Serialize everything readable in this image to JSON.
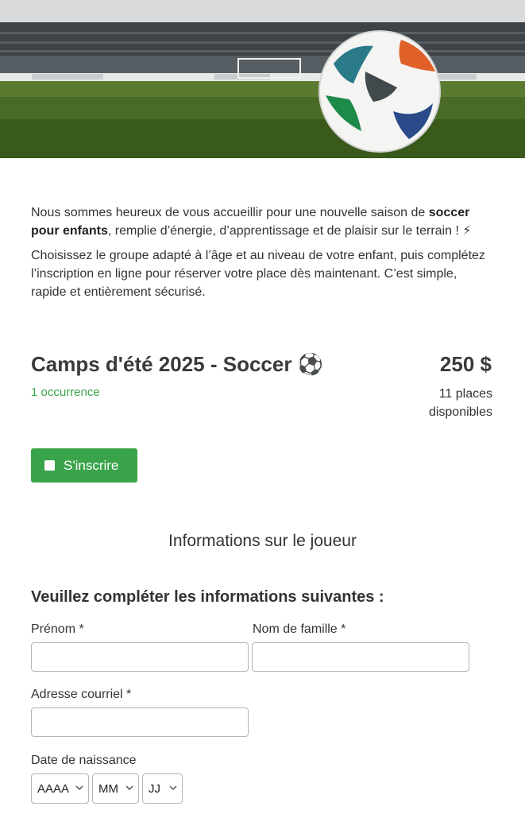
{
  "hero": {
    "image_name": "soccer-ball-stadium-image"
  },
  "intro": {
    "p1_a": "Nous sommes heureux de vous accueillir pour une nouvelle saison de",
    "p1_bold": "soccer pour enfants",
    "p1_b": ", remplie d’énergie, d’apprentissage et de plaisir sur le terrain ! ⚡",
    "p2": "Choisissez le groupe adapté à l’âge et au niveau de votre enfant, puis complétez l’inscription en ligne pour réserver votre place dès maintenant. C’est simple, rapide et entièrement sécurisé."
  },
  "event": {
    "title": "Camps d'été 2025 - Soccer ⚽",
    "occurrences": "1 occurrence",
    "price": "250 $",
    "places": "11 places disponibles"
  },
  "register_button": {
    "label": "S'inscrire"
  },
  "player_section": {
    "title": "Informations sur le joueur"
  },
  "form": {
    "heading": "Veuillez compléter les informations suivantes :",
    "first_name_label": "Prénom *",
    "last_name_label": "Nom de famille *",
    "email_label": "Adresse courriel *",
    "birthdate_label": "Date de naissance",
    "year_select": "AAAA",
    "month_select": "MM",
    "day_select": "JJ"
  },
  "colors": {
    "accent": "#3aa44a",
    "text": "#333333"
  }
}
